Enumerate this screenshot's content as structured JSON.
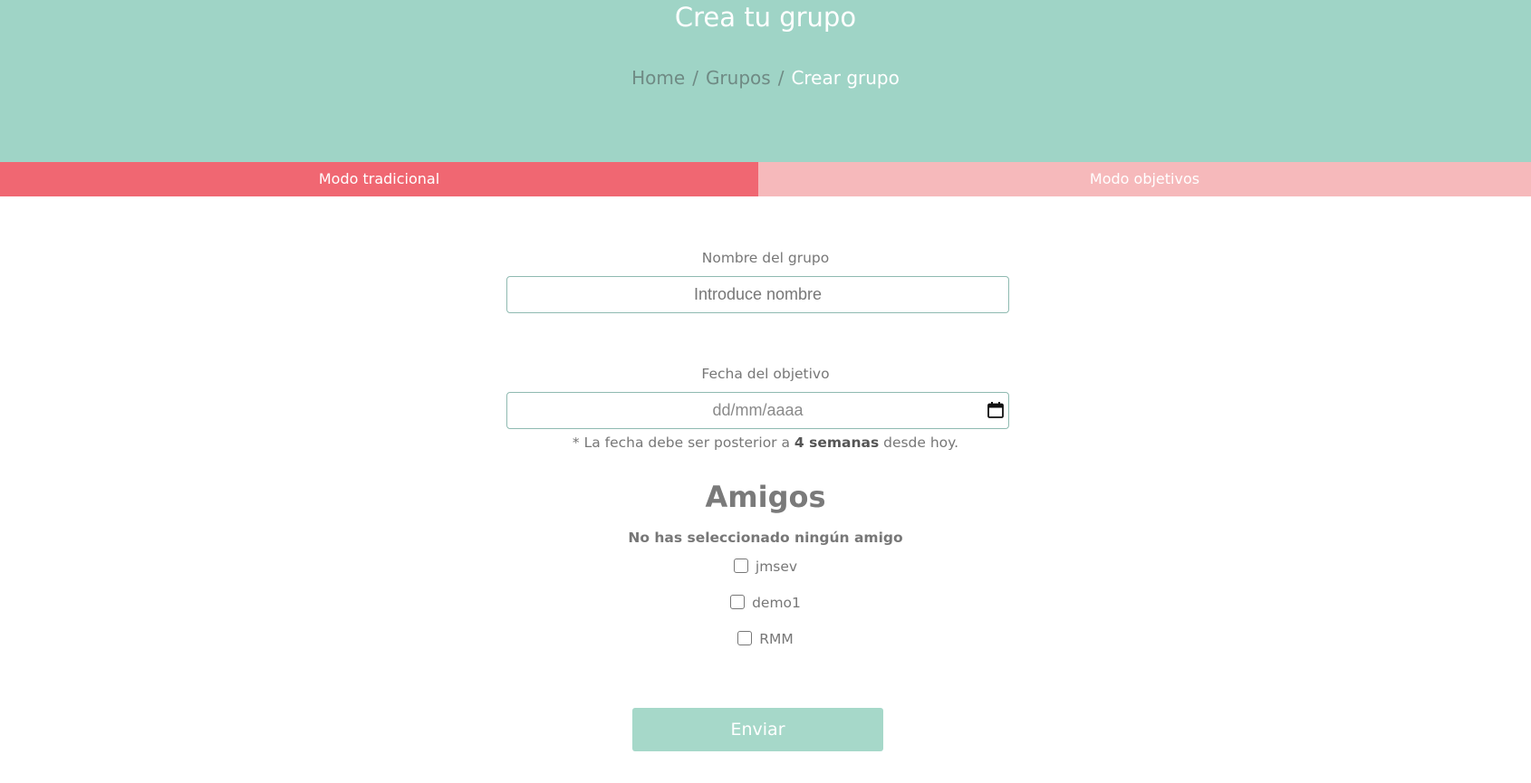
{
  "header": {
    "title": "Crea tu grupo",
    "breadcrumb": {
      "home": "Home",
      "separator": "/",
      "groups": "Grupos",
      "current": "Crear grupo"
    }
  },
  "tabs": {
    "traditional": "Modo tradicional",
    "objectives": "Modo objetivos",
    "active": "traditional"
  },
  "form": {
    "name_label": "Nombre del grupo",
    "name_placeholder": "Introduce nombre",
    "name_value": "",
    "date_label": "Fecha del objetivo",
    "date_placeholder": "dd/mm/aaaa",
    "hint_prefix": "* La fecha debe ser posterior a ",
    "hint_bold": "4 semanas",
    "hint_suffix": " desde hoy."
  },
  "friends": {
    "title": "Amigos",
    "none_selected": "No has seleccionado ningún amigo",
    "list": [
      {
        "name": "jmsev",
        "checked": false
      },
      {
        "name": "demo1",
        "checked": false
      },
      {
        "name": "RMM",
        "checked": false
      }
    ]
  },
  "submit_label": "Enviar",
  "colors": {
    "header_bg": "#9fd4c6",
    "tab_active": "#f06772",
    "tab_inactive": "#f6b9bb",
    "submit_bg": "#a6d8c9"
  }
}
